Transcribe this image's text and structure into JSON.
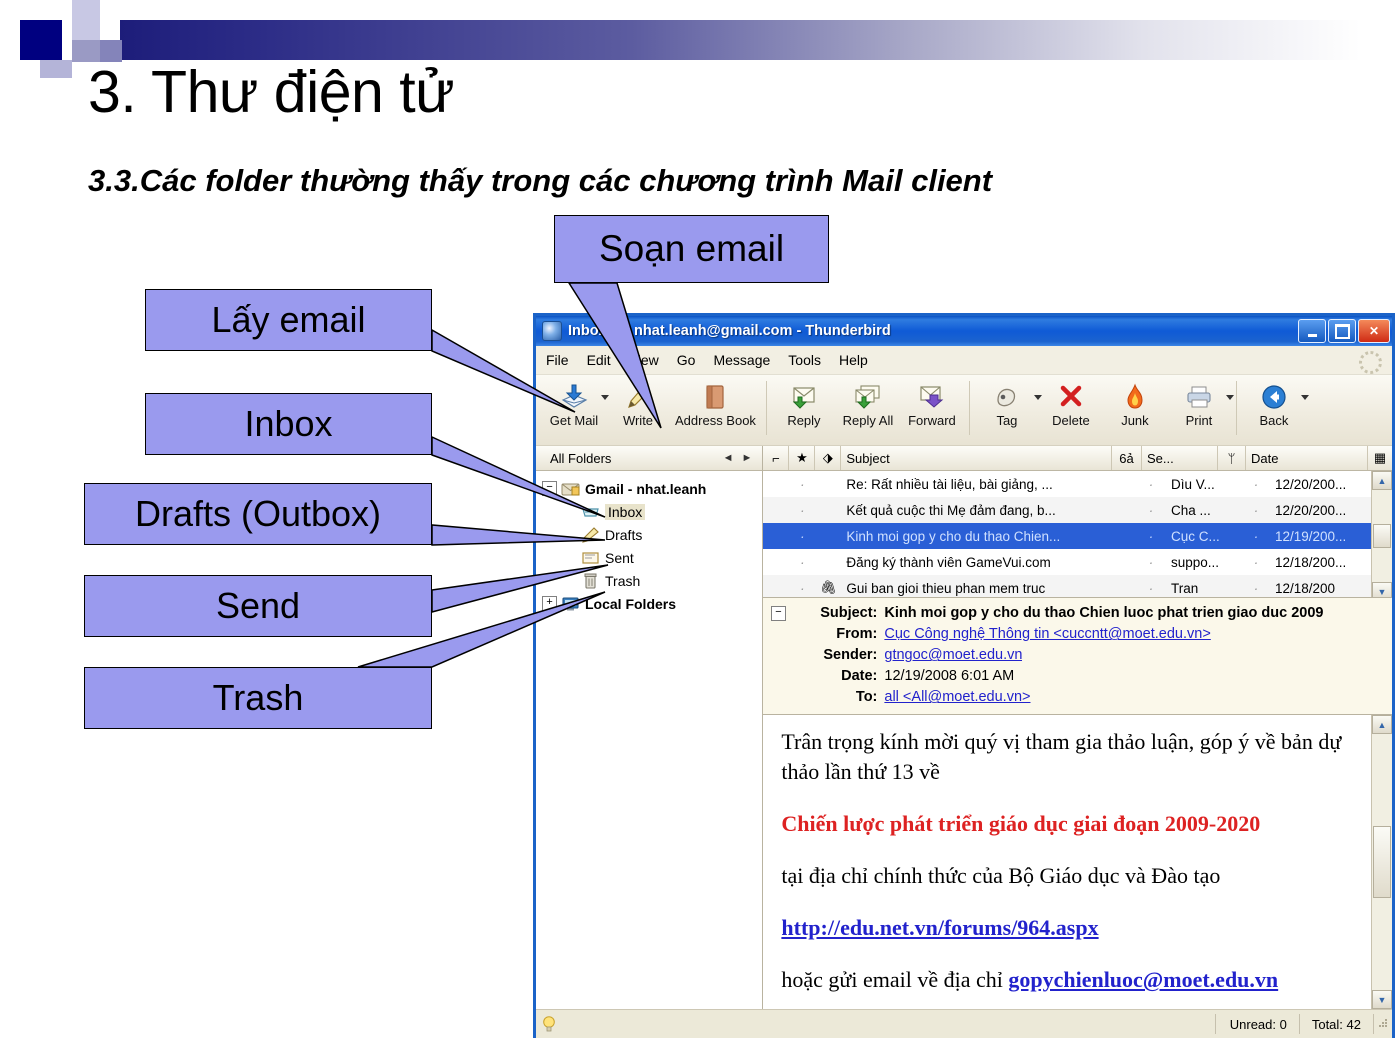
{
  "slide": {
    "title": "3. Thư điện tử",
    "subtitle": "3.3.Các folder thường thấy trong các chương trình Mail client"
  },
  "callouts": {
    "compose": "Soạn email",
    "get_mail": "Lấy email",
    "inbox": "Inbox",
    "drafts": "Drafts (Outbox)",
    "send": "Send",
    "trash": "Trash"
  },
  "colors": {
    "callout_fill": "#9a9aee",
    "title_bar": "#0f5ad6",
    "selection": "#2a5fd6",
    "body_red": "#dd2222",
    "link": "#2222cc"
  },
  "window": {
    "title": "Inbox for nhat.leanh@gmail.com - Thunderbird",
    "controls": {
      "minimize": "Minimize",
      "maximize": "Maximize",
      "close": "Close"
    },
    "menus": [
      "File",
      "Edit",
      "View",
      "Go",
      "Message",
      "Tools",
      "Help"
    ],
    "toolbar": [
      {
        "label": "Get Mail",
        "icon": "get-mail-icon",
        "dropdown": true
      },
      {
        "label": "Write",
        "icon": "write-icon",
        "dropdown": false
      },
      {
        "label": "Address Book",
        "icon": "address-book-icon",
        "dropdown": false
      },
      {
        "label": "Reply",
        "icon": "reply-icon",
        "dropdown": false
      },
      {
        "label": "Reply All",
        "icon": "reply-all-icon",
        "dropdown": false
      },
      {
        "label": "Forward",
        "icon": "forward-icon",
        "dropdown": false
      },
      {
        "label": "Tag",
        "icon": "tag-icon",
        "dropdown": true
      },
      {
        "label": "Delete",
        "icon": "delete-icon",
        "dropdown": false
      },
      {
        "label": "Junk",
        "icon": "junk-icon",
        "dropdown": false
      },
      {
        "label": "Print",
        "icon": "print-icon",
        "dropdown": true
      },
      {
        "label": "Back",
        "icon": "back-icon",
        "dropdown": true
      }
    ],
    "folders": {
      "header": "All Folders",
      "account": "Gmail - nhat.leanh",
      "items": [
        {
          "label": "Inbox",
          "icon": "inbox-icon",
          "selected": true
        },
        {
          "label": "Drafts",
          "icon": "drafts-icon",
          "selected": false
        },
        {
          "label": "Sent",
          "icon": "sent-icon",
          "selected": false
        },
        {
          "label": "Trash",
          "icon": "trash-icon",
          "selected": false
        }
      ],
      "local": "Local Folders"
    },
    "message_list": {
      "columns": [
        "Subject",
        "Se...",
        "Date"
      ],
      "rows": [
        {
          "subject": "Re: Rất nhiều tài liệu, bài giảng, ...",
          "sender": "Dìu V...",
          "date": "12/20/200...",
          "selected": false
        },
        {
          "subject": "Kết quả cuộc thi Mẹ đảm đang, b...",
          "sender": "Cha ...",
          "date": "12/20/200...",
          "selected": false
        },
        {
          "subject": "Kinh moi gop y cho du thao Chien...",
          "sender": "Cục C...",
          "date": "12/19/200...",
          "selected": true
        },
        {
          "subject": "Đăng ký thành viên GameVui.com",
          "sender": "suppo...",
          "date": "12/18/200...",
          "selected": false
        },
        {
          "subject": "Gui ban gioi thieu phan mem truc",
          "sender": "Tran",
          "date": "12/18/200",
          "selected": false
        }
      ]
    },
    "message_header": {
      "subject_label": "Subject:",
      "subject_value": "Kinh moi gop y cho du thao Chien luoc phat trien giao duc 2009",
      "from_label": "From:",
      "from_value": "Cục Công nghệ Thông tin <cuccntt@moet.edu.vn>",
      "sender_label": "Sender:",
      "sender_value": "gtngoc@moet.edu.vn",
      "date_label": "Date:",
      "date_value": "12/19/2008 6:01 AM",
      "to_label": "To:",
      "to_value": "all <All@moet.edu.vn>"
    },
    "message_body": {
      "line1": "Trân trọng kính mời quý vị tham gia thảo luận, góp ý về bản dự thảo lần thứ 13 về",
      "line2": "Chiến lược phát triển giáo dục giai đoạn 2009-2020",
      "line3": "tại địa chỉ chính thức của Bộ Giáo dục và Đào tạo",
      "line4": "http://edu.net.vn/forums/964.aspx",
      "line5_prefix": "hoặc gửi email về địa chỉ ",
      "line5_link": "gopychienluoc@moet.edu.vn"
    },
    "status_bar": {
      "unread": "Unread: 0",
      "total": "Total: 42"
    }
  }
}
